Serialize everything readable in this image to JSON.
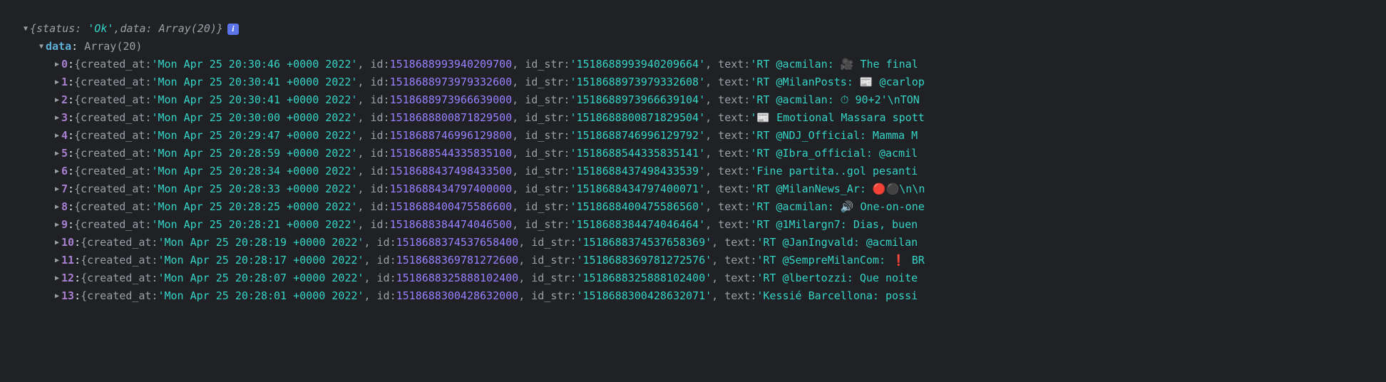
{
  "root": {
    "status": "'Ok'",
    "status_key": "status:",
    "data_key": "data:",
    "data_type": "Array(20)",
    "info": "i"
  },
  "data_line": {
    "key": "data",
    "type": "Array(20)"
  },
  "rows": [
    {
      "idx": "0",
      "prefix": "{created_at: ",
      "created_at": "'Mon Apr 25 20:30:46 +0000 2022'",
      "id_key": ", id: ",
      "id": "1518688993940209700",
      "id_str_key": ", id_str: ",
      "id_str": "'1518688993940209664'",
      "text_key": ", text: ",
      "text": "'RT @acmilan: 🎥 The final "
    },
    {
      "idx": "1",
      "prefix": "{created_at: ",
      "created_at": "'Mon Apr 25 20:30:41 +0000 2022'",
      "id_key": ", id: ",
      "id": "1518688973979332600",
      "id_str_key": ", id_str: ",
      "id_str": "'1518688973979332608'",
      "text_key": ", text: ",
      "text": "'RT @MilanPosts: 📰 @carlop"
    },
    {
      "idx": "2",
      "prefix": "{created_at: ",
      "created_at": "'Mon Apr 25 20:30:41 +0000 2022'",
      "id_key": ", id: ",
      "id": "1518688973966639000",
      "id_str_key": ", id_str: ",
      "id_str": "'1518688973966639104'",
      "text_key": ", text: ",
      "text": "'RT @acmilan: ⏱ 90+2'\\nTON"
    },
    {
      "idx": "3",
      "prefix": "{created_at: ",
      "created_at": "'Mon Apr 25 20:30:00 +0000 2022'",
      "id_key": ", id: ",
      "id": "1518688800871829500",
      "id_str_key": ", id_str: ",
      "id_str": "'1518688800871829504'",
      "text_key": ", text: ",
      "text": "'📰 Emotional Massara spott"
    },
    {
      "idx": "4",
      "prefix": "{created_at: ",
      "created_at": "'Mon Apr 25 20:29:47 +0000 2022'",
      "id_key": ", id: ",
      "id": "1518688746996129800",
      "id_str_key": ", id_str: ",
      "id_str": "'1518688746996129792'",
      "text_key": ", text: ",
      "text": "'RT @NDJ_Official: Mamma M"
    },
    {
      "idx": "5",
      "prefix": "{created_at: ",
      "created_at": "'Mon Apr 25 20:28:59 +0000 2022'",
      "id_key": ", id: ",
      "id": "1518688544335835100",
      "id_str_key": ", id_str: ",
      "id_str": "'1518688544335835141'",
      "text_key": ", text: ",
      "text": "'RT @Ibra_official: @acmil"
    },
    {
      "idx": "6",
      "prefix": "{created_at: ",
      "created_at": "'Mon Apr 25 20:28:34 +0000 2022'",
      "id_key": ", id: ",
      "id": "1518688437498433500",
      "id_str_key": ", id_str: ",
      "id_str": "'1518688437498433539'",
      "text_key": ", text: ",
      "text": "'Fine partita..gol pesanti"
    },
    {
      "idx": "7",
      "prefix": "{created_at: ",
      "created_at": "'Mon Apr 25 20:28:33 +0000 2022'",
      "id_key": ", id: ",
      "id": "1518688434797400000",
      "id_str_key": ", id_str: ",
      "id_str": "'1518688434797400071'",
      "text_key": ", text: ",
      "text": "'RT @MilanNews_Ar: 🔴⚫\\n\\n"
    },
    {
      "idx": "8",
      "prefix": "{created_at: ",
      "created_at": "'Mon Apr 25 20:28:25 +0000 2022'",
      "id_key": ", id: ",
      "id": "1518688400475586600",
      "id_str_key": ", id_str: ",
      "id_str": "'1518688400475586560'",
      "text_key": ", text: ",
      "text": "'RT @acmilan: 🔊 One-on-one"
    },
    {
      "idx": "9",
      "prefix": "{created_at: ",
      "created_at": "'Mon Apr 25 20:28:21 +0000 2022'",
      "id_key": ", id: ",
      "id": "1518688384474046500",
      "id_str_key": ", id_str: ",
      "id_str": "'1518688384474046464'",
      "text_key": ", text: ",
      "text": "'RT @1Milargn7: Dias, buen"
    },
    {
      "idx": "10",
      "prefix": "{created_at: ",
      "created_at": "'Mon Apr 25 20:28:19 +0000 2022'",
      "id_key": ", id: ",
      "id": "1518688374537658400",
      "id_str_key": ", id_str: ",
      "id_str": "'1518688374537658369'",
      "text_key": ", text: ",
      "text": "'RT @JanIngvald: @acmilan "
    },
    {
      "idx": "11",
      "prefix": "{created_at: ",
      "created_at": "'Mon Apr 25 20:28:17 +0000 2022'",
      "id_key": ", id: ",
      "id": "1518688369781272600",
      "id_str_key": ", id_str: ",
      "id_str": "'1518688369781272576'",
      "text_key": ", text: ",
      "text": "'RT @SempreMilanCom: ❗ BR"
    },
    {
      "idx": "12",
      "prefix": "{created_at: ",
      "created_at": "'Mon Apr 25 20:28:07 +0000 2022'",
      "id_key": ", id: ",
      "id": "1518688325888102400",
      "id_str_key": ", id_str: ",
      "id_str": "'1518688325888102400'",
      "text_key": ", text: ",
      "text": "'RT @lbertozzi: Que noite "
    },
    {
      "idx": "13",
      "prefix": "{created_at: ",
      "created_at": "'Mon Apr 25 20:28:01 +0000 2022'",
      "id_key": ", id: ",
      "id": "1518688300428632000",
      "id_str_key": ", id_str: ",
      "id_str": "'1518688300428632071'",
      "text_key": ", text: ",
      "text": "'Kessié Barcellona: possi"
    }
  ]
}
